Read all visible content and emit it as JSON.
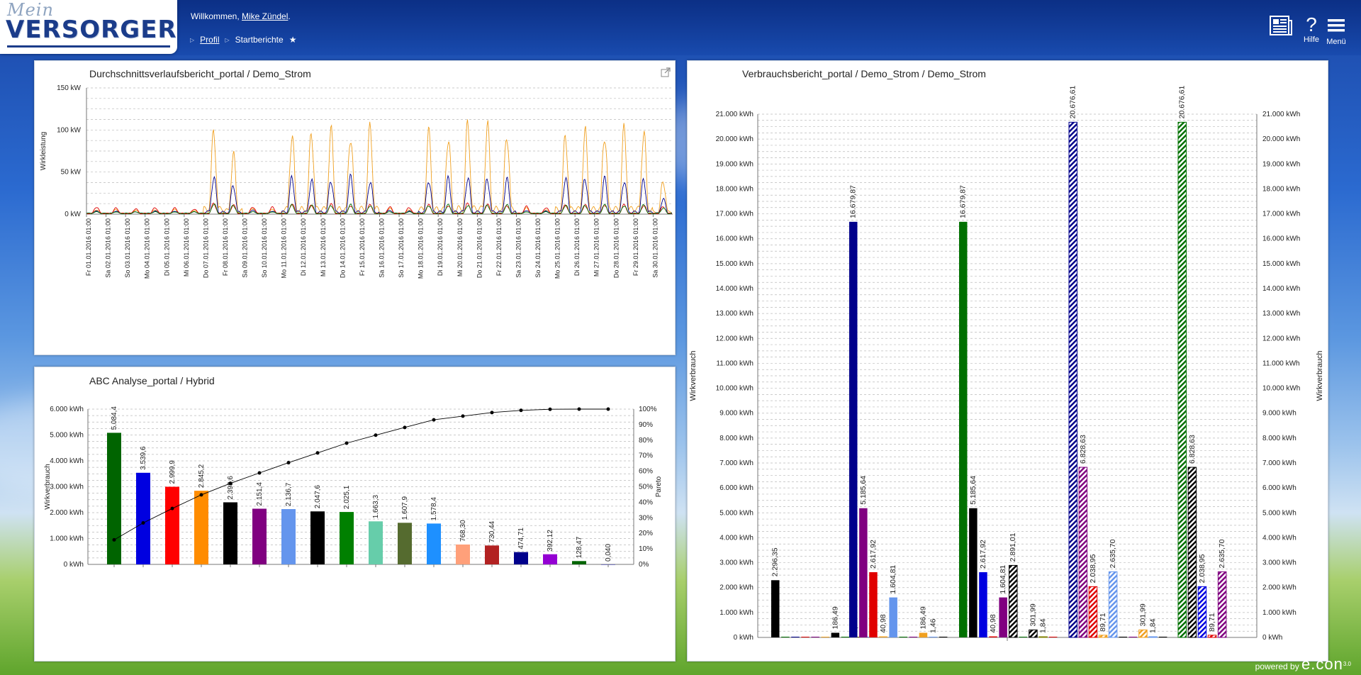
{
  "header": {
    "logo_top": "Mein",
    "logo_main": "VERSORGER",
    "welcome_prefix": "Willkommen,",
    "user_name": "Mike Zündel",
    "welcome_suffix": ".",
    "breadcrumbs": [
      "Profil",
      "Startberichte"
    ],
    "help_label": "Hilfe",
    "help_glyph": "?",
    "menu_label": "Menü"
  },
  "footer": {
    "powered_prefix": "powered by",
    "brand": "e.con",
    "brand_sup": "3.0"
  },
  "colors": {
    "orange": "#f0a020",
    "blue": "#00008b",
    "red": "#e00000",
    "green": "#007000",
    "black": "#000000",
    "purple": "#800080"
  },
  "icons": {
    "report_icon": "newspaper-icon",
    "help_icon": "question-icon",
    "menu_icon": "hamburger-icon",
    "popout_icon": "external-link-icon"
  },
  "panels": {
    "avg": {
      "title": "Durchschnittsverlaufsbericht_portal / Demo_Strom"
    },
    "abc": {
      "title": "ABC Analyse_portal / Hybrid"
    },
    "cons": {
      "title": "Verbrauchsbericht_portal / Demo_Strom / Demo_Strom"
    }
  },
  "chart_data": [
    {
      "id": "avg",
      "type": "line",
      "title": "Durchschnittsverlaufsbericht_portal / Demo_Strom",
      "ylabel": "Wirkleistung",
      "ylim": [
        0,
        150
      ],
      "yticks": [
        "0 kW",
        "50 kW",
        "100 kW",
        "150 kW"
      ],
      "ytick_values": [
        0,
        50,
        100,
        150
      ],
      "x": [
        "Fr 01.01.2016 01:00",
        "Sa 02.01.2016 01:00",
        "So 03.01.2016 01:00",
        "Mo 04.01.2016 01:00",
        "Di 05.01.2016 01:00",
        "Mi 06.01.2016 01:00",
        "Do 07.01.2016 01:00",
        "Fr 08.01.2016 01:00",
        "Sa 09.01.2016 01:00",
        "So 10.01.2016 01:00",
        "Mo 11.01.2016 01:00",
        "Di 12.01.2016 01:00",
        "Mi 13.01.2016 01:00",
        "Do 14.01.2016 01:00",
        "Fr 15.01.2016 01:00",
        "Sa 16.01.2016 01:00",
        "So 17.01.2016 01:00",
        "Mo 18.01.2016 01:00",
        "Di 19.01.2016 01:00",
        "Mi 20.01.2016 01:00",
        "Do 21.01.2016 01:00",
        "Fr 22.01.2016 01:00",
        "Sa 23.01.2016 01:00",
        "So 24.01.2016 01:00",
        "Mo 25.01.2016 01:00",
        "Di 26.01.2016 01:00",
        "Mi 27.01.2016 01:00",
        "Do 28.01.2016 01:00",
        "Fr 29.01.2016 01:00",
        "Sa 30.01.2016 01:00"
      ],
      "series": [
        {
          "color": "#f0a020",
          "daily_peaks": [
            6,
            6,
            5,
            6,
            6,
            5,
            110,
            78,
            8,
            6,
            108,
            110,
            108,
            110,
            113,
            8,
            6,
            105,
            108,
            120,
            118,
            112,
            8,
            6,
            105,
            108,
            112,
            110,
            112,
            45
          ]
        },
        {
          "color": "#00008b",
          "daily_peaks": [
            4,
            4,
            3,
            4,
            4,
            3,
            50,
            40,
            5,
            4,
            48,
            45,
            47,
            48,
            46,
            5,
            4,
            48,
            46,
            50,
            48,
            45,
            5,
            4,
            48,
            50,
            46,
            47,
            45,
            20
          ]
        },
        {
          "color": "#e00000",
          "daily_peaks": [
            10,
            8,
            7,
            9,
            8,
            7,
            14,
            12,
            10,
            9,
            14,
            12,
            13,
            12,
            12,
            10,
            9,
            12,
            12,
            14,
            13,
            12,
            10,
            9,
            12,
            12,
            13,
            12,
            12,
            10
          ]
        },
        {
          "color": "#007000",
          "daily_peaks": [
            3,
            3,
            3,
            3,
            3,
            3,
            14,
            12,
            3,
            3,
            12,
            12,
            12,
            12,
            12,
            3,
            3,
            12,
            12,
            12,
            12,
            12,
            3,
            3,
            12,
            12,
            12,
            12,
            12,
            8
          ]
        }
      ]
    },
    {
      "id": "abc",
      "type": "bar",
      "title": "ABC Analyse_portal / Hybrid",
      "ylabel": "Wirkverbrauch",
      "y2label": "Pareto",
      "ylim": [
        0,
        6000
      ],
      "yticks": [
        "0 kWh",
        "1.000 kWh",
        "2.000 kWh",
        "3.000 kWh",
        "4.000 kWh",
        "5.000 kWh",
        "6.000 kWh"
      ],
      "ytick_values": [
        0,
        1000,
        2000,
        3000,
        4000,
        5000,
        6000
      ],
      "y2ticks": [
        "0%",
        "10%",
        "20%",
        "30%",
        "40%",
        "50%",
        "60%",
        "70%",
        "80%",
        "90%",
        "100%"
      ],
      "y2tick_values": [
        0,
        10,
        20,
        30,
        40,
        50,
        60,
        70,
        80,
        90,
        100
      ],
      "values": [
        5084.4,
        3539.6,
        2999.9,
        2845.2,
        2398.6,
        2151.4,
        2136.7,
        2047.6,
        2025.1,
        1663.3,
        1607.9,
        1578.4,
        768.3,
        730.44,
        474.71,
        392.12,
        128.47,
        0.04
      ],
      "labels": [
        "5.084,4",
        "3.539,6",
        "2.999,9",
        "2.845,2",
        "2.398,6",
        "2.151,4",
        "2.136,7",
        "2.047,6",
        "2.025,1",
        "1.663,3",
        "1.607,9",
        "1.578,4",
        "768,30",
        "730,44",
        "474,71",
        "392,12",
        "128,47",
        "0,040"
      ],
      "colors": [
        "#006400",
        "#0000e0",
        "#ff0000",
        "#ff8c00",
        "#000000",
        "#800080",
        "#6495ed",
        "#000000",
        "#008000",
        "#66cdaa",
        "#556b2f",
        "#1e90ff",
        "#ffa07a",
        "#b22222",
        "#00008b",
        "#9400d3",
        "#006400",
        "#00008b"
      ],
      "label_colors": [
        "#006400",
        "#0000e0",
        "#ff0000",
        "#ff8c00",
        "#000000",
        "#800080",
        "#6495ed",
        "#000000",
        "#008000",
        "#66cdaa",
        "#556b2f",
        "#1e90ff",
        "#ffa07a",
        "#b22222",
        "#00008b",
        "#9400d3",
        "#006400",
        "#00008b"
      ],
      "pareto": [
        15.8,
        26.7,
        36.0,
        44.8,
        52.2,
        58.9,
        65.5,
        71.8,
        78.1,
        83.2,
        88.2,
        93.1,
        95.5,
        97.8,
        99.2,
        99.9,
        100,
        100
      ]
    },
    {
      "id": "cons",
      "type": "bar",
      "title": "Verbrauchsbericht_portal / Demo_Strom / Demo_Strom",
      "ylabel": "Wirkverbrauch",
      "y2label": "Wirkverbrauch",
      "ylim": [
        0,
        21000
      ],
      "yticks": [
        "0 kWh",
        "1.000 kWh",
        "2.000 kWh",
        "3.000 kWh",
        "4.000 kWh",
        "5.000 kWh",
        "6.000 kWh",
        "7.000 kWh",
        "8.000 kWh",
        "9.000 kWh",
        "10.000 kWh",
        "11.000 kWh",
        "12.000 kWh",
        "13.000 kWh",
        "14.000 kWh",
        "15.000 kWh",
        "16.000 kWh",
        "17.000 kWh",
        "18.000 kWh",
        "19.000 kWh",
        "20.000 kWh",
        "21.000 kWh"
      ],
      "ytick_values": [
        0,
        1000,
        2000,
        3000,
        4000,
        5000,
        6000,
        7000,
        8000,
        9000,
        10000,
        11000,
        12000,
        13000,
        14000,
        15000,
        16000,
        17000,
        18000,
        19000,
        20000,
        21000
      ],
      "groups": [
        {
          "bars": [
            {
              "value": 2296.35,
              "label": "2.296,35",
              "color": "#000000",
              "hatch": false
            },
            {
              "value": 10,
              "label": "",
              "color": "#007000",
              "hatch": false
            },
            {
              "value": 10,
              "label": "",
              "color": "#00008b",
              "hatch": false
            },
            {
              "value": 10,
              "label": "",
              "color": "#e00000",
              "hatch": false
            },
            {
              "value": 10,
              "label": "",
              "color": "#800080",
              "hatch": false
            },
            {
              "value": 10,
              "label": "",
              "color": "#f0a020",
              "hatch": false
            },
            {
              "value": 186.49,
              "label": "186,49",
              "color": "#000000",
              "hatch": false
            },
            {
              "value": 10,
              "label": "",
              "color": "#007000",
              "hatch": false
            },
            {
              "value": 1.46,
              "label": "1,46",
              "color": "#808000",
              "hatch": false
            },
            {
              "value": 10,
              "label": "",
              "color": "#6495ed",
              "hatch": false
            },
            {
              "value": 10,
              "label": "",
              "color": "#ffa07a",
              "hatch": false
            }
          ]
        },
        {
          "bars": [
            {
              "value": 16679.87,
              "label": "16.679,87",
              "color": "#00008b",
              "hatch": false
            },
            {
              "value": 5185.64,
              "label": "5.185,64",
              "color": "#800080",
              "hatch": false
            },
            {
              "value": 2617.92,
              "label": "2.617,92",
              "color": "#e00000",
              "hatch": false
            },
            {
              "value": 40.98,
              "label": "40,98",
              "color": "#f0a020",
              "hatch": false
            },
            {
              "value": 1604.81,
              "label": "1.604,81",
              "color": "#6495ed",
              "hatch": false
            },
            {
              "value": 10,
              "label": "",
              "color": "#007000",
              "hatch": false
            },
            {
              "value": 10,
              "label": "",
              "color": "#800080",
              "hatch": false
            },
            {
              "value": 186.49,
              "label": "186,49",
              "color": "#f0a020",
              "hatch": false
            },
            {
              "value": 1.46,
              "label": "1,46",
              "color": "#6495ed",
              "hatch": false
            },
            {
              "value": 10,
              "label": "",
              "color": "#000000",
              "hatch": false
            }
          ]
        },
        {
          "bars": [
            {
              "value": 16679.87,
              "label": "16.679,87",
              "color": "#007000",
              "hatch": false
            },
            {
              "value": 5185.64,
              "label": "5.185,64",
              "color": "#000000",
              "hatch": false
            },
            {
              "value": 2617.92,
              "label": "2.617,92",
              "color": "#0000e0",
              "hatch": false
            },
            {
              "value": 40.98,
              "label": "40,98",
              "color": "#e00000",
              "hatch": false
            },
            {
              "value": 1604.81,
              "label": "1.604,81",
              "color": "#800080",
              "hatch": false
            },
            {
              "value": 2891.01,
              "label": "2.891,01",
              "color": "#000000",
              "hatch": true
            },
            {
              "value": 10,
              "label": "",
              "color": "#007000",
              "hatch": false
            },
            {
              "value": 301.99,
              "label": "301,99",
              "color": "#000000",
              "hatch": true
            },
            {
              "value": 1.84,
              "label": "1,84",
              "color": "#808000",
              "hatch": true
            },
            {
              "value": 10,
              "label": "",
              "color": "#e00000",
              "hatch": false
            }
          ]
        },
        {
          "bars": [
            {
              "value": 20676.61,
              "label": "20.676,61",
              "color": "#00008b",
              "hatch": true
            },
            {
              "value": 6828.63,
              "label": "6.828,63",
              "color": "#800080",
              "hatch": true
            },
            {
              "value": 2038.95,
              "label": "2.038,95",
              "color": "#e00000",
              "hatch": true
            },
            {
              "value": 89.71,
              "label": "89,71",
              "color": "#f0a020",
              "hatch": true
            },
            {
              "value": 2635.7,
              "label": "2.635,70",
              "color": "#6495ed",
              "hatch": true
            },
            {
              "value": 10,
              "label": "",
              "color": "#000000",
              "hatch": false
            },
            {
              "value": 10,
              "label": "",
              "color": "#800080",
              "hatch": false
            },
            {
              "value": 301.99,
              "label": "301,99",
              "color": "#f0a020",
              "hatch": true
            },
            {
              "value": 1.84,
              "label": "1,84",
              "color": "#6495ed",
              "hatch": true
            },
            {
              "value": 10,
              "label": "",
              "color": "#000000",
              "hatch": false
            }
          ]
        },
        {
          "bars": [
            {
              "value": 20676.61,
              "label": "20.676,61",
              "color": "#007000",
              "hatch": true
            },
            {
              "value": 6828.63,
              "label": "6.828,63",
              "color": "#000000",
              "hatch": true
            },
            {
              "value": 2038.95,
              "label": "2.038,95",
              "color": "#0000e0",
              "hatch": true
            },
            {
              "value": 89.71,
              "label": "89,71",
              "color": "#e00000",
              "hatch": true
            },
            {
              "value": 2635.7,
              "label": "2.635,70",
              "color": "#800080",
              "hatch": true
            }
          ]
        }
      ]
    }
  ]
}
